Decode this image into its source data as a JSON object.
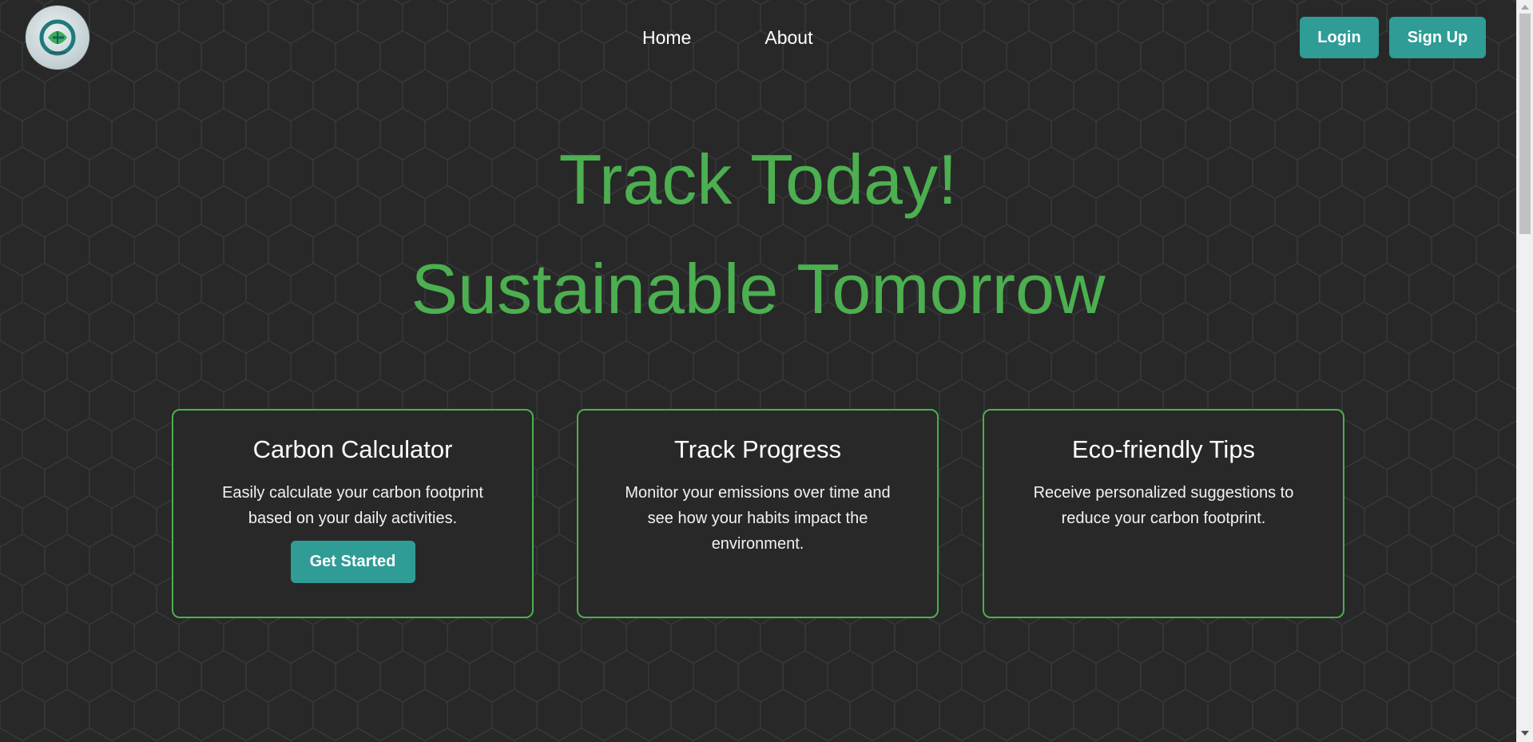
{
  "colors": {
    "background": "#282828",
    "accent_green": "#4caf50",
    "button_teal": "#2f9c96",
    "text_white": "#ffffff"
  },
  "logo": {
    "icon": "leaf-logo-icon"
  },
  "nav": {
    "home": "Home",
    "about": "About"
  },
  "auth": {
    "login": "Login",
    "signup": "Sign Up"
  },
  "hero": {
    "line1": "Track Today!",
    "line2": "Sustainable Tomorrow"
  },
  "cards": [
    {
      "title": "Carbon Calculator",
      "text": "Easily calculate your carbon footprint based on your daily activities.",
      "button": "Get Started"
    },
    {
      "title": "Track Progress",
      "text": "Monitor your emissions over time and see how your habits impact the environment."
    },
    {
      "title": "Eco-friendly Tips",
      "text": "Receive personalized suggestions to reduce your carbon footprint."
    }
  ]
}
